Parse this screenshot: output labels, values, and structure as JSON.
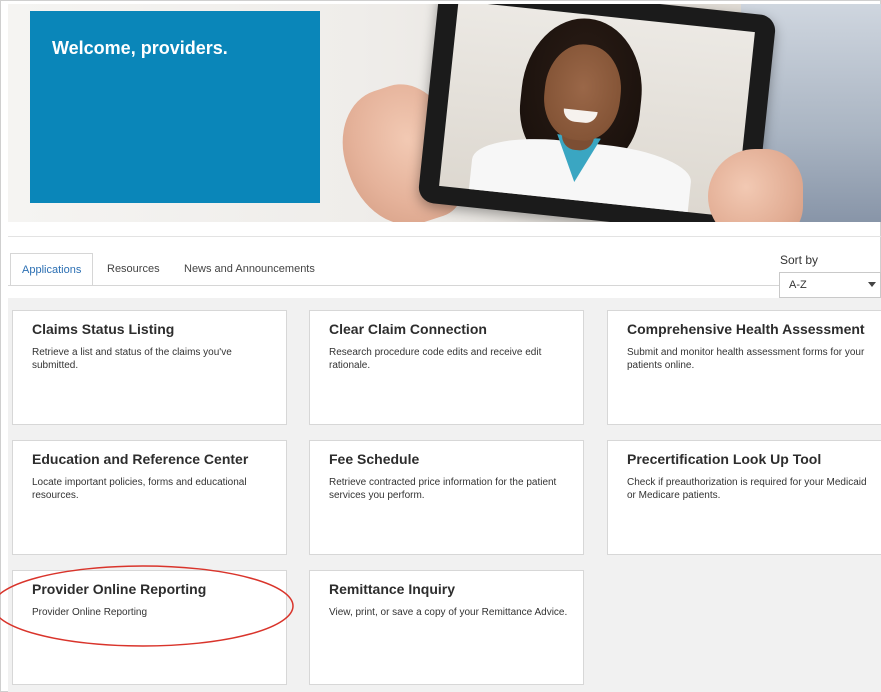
{
  "hero": {
    "welcome_text": "Welcome, providers.",
    "accent_color": "#0a86b9"
  },
  "tabs": [
    {
      "label": "Applications",
      "active": true
    },
    {
      "label": "Resources",
      "active": false
    },
    {
      "label": "News and Announcements",
      "active": false
    }
  ],
  "sort": {
    "label": "Sort by",
    "selected": "A-Z"
  },
  "cards": [
    {
      "title": "Claims Status Listing",
      "description": "Retrieve a list and status of the claims you've submitted."
    },
    {
      "title": "Clear Claim Connection",
      "description": "Research procedure code edits and receive edit rationale."
    },
    {
      "title": "Comprehensive Health Assessment",
      "description": "Submit and monitor health assessment forms for your patients online."
    },
    {
      "title": "Education and Reference Center",
      "description": "Locate important policies, forms and educational resources."
    },
    {
      "title": "Fee Schedule",
      "description": "Retrieve contracted price information for the patient services you perform."
    },
    {
      "title": "Precertification Look Up Tool",
      "description": "Check if preauthorization is required for your Medicaid or Medicare patients."
    },
    {
      "title": "Provider Online Reporting",
      "description": "Provider Online Reporting"
    },
    {
      "title": "Remittance Inquiry",
      "description": "View, print, or save a copy of your Remittance Advice."
    }
  ],
  "annotation": {
    "shape": "ellipse",
    "color": "#d9342b",
    "highlights": "Provider Online Reporting"
  }
}
